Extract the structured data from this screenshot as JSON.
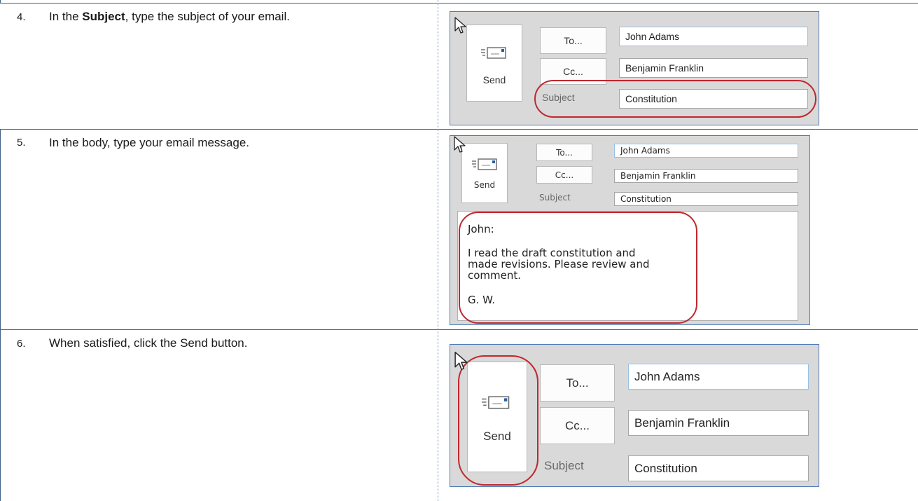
{
  "steps": [
    {
      "number": "4.",
      "text_bold": "Subject",
      "text_before": "In the ",
      "text_after": ", type the subject of your email."
    },
    {
      "number": "5.",
      "text": "In the body, type your email message."
    },
    {
      "number": "6.",
      "text": "When satisfied, click the Send button."
    }
  ],
  "compose": {
    "send_label": "Send",
    "to_label": "To...",
    "cc_label": "Cc...",
    "subject_label": "Subject",
    "to_value": "John Adams",
    "cc_value": "Benjamin Franklin",
    "subject_value": "Constitution"
  },
  "message": {
    "greeting": "John:",
    "line1": "I read the draft constitution and",
    "line2": "made revisions. Please review and",
    "line3": "comment.",
    "signature": "G. W."
  },
  "highlight_color": "#c0272d",
  "icons": [
    "mouse-cursor-icon",
    "send-envelope-icon"
  ]
}
